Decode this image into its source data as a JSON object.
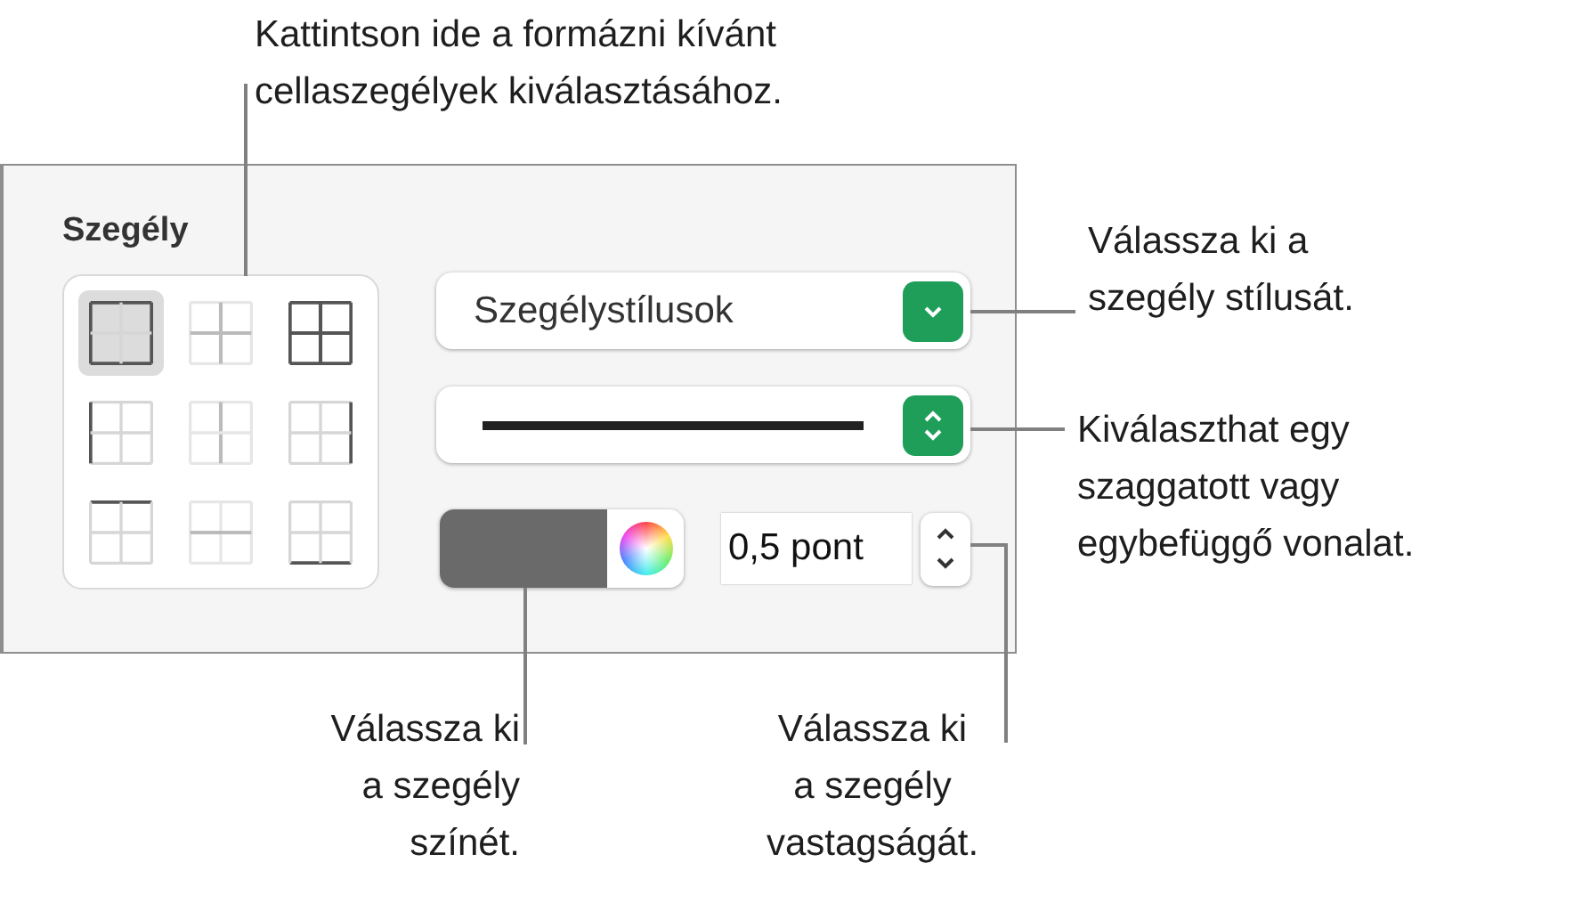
{
  "panel": {
    "title": "Szegély",
    "border_grid": [
      {
        "kind": "outer",
        "selected": true
      },
      {
        "kind": "inner",
        "selected": false
      },
      {
        "kind": "all",
        "selected": false
      },
      {
        "kind": "left",
        "selected": false
      },
      {
        "kind": "inner-vertical",
        "selected": false
      },
      {
        "kind": "right",
        "selected": false
      },
      {
        "kind": "top",
        "selected": false
      },
      {
        "kind": "inner-horizontal",
        "selected": false
      },
      {
        "kind": "bottom",
        "selected": false
      }
    ],
    "style_popup": {
      "value": "Szegélystílusok"
    },
    "line_popup": {
      "kind": "solid"
    },
    "color_well": {
      "color": "#6a6a6a"
    },
    "width_field": {
      "value": "0,5 pont"
    }
  },
  "callouts": [
    {
      "kind": "top",
      "text": "Kattintson ide a formázni kívánt\ncellaszegélyek kiválasztásához."
    },
    {
      "kind": "style",
      "text": "Válassza ki a\nszegély stílusát."
    },
    {
      "kind": "line",
      "text": "Kiválaszthat egy\nszaggatott vagy\negybefüggő vonalat."
    },
    {
      "kind": "color",
      "text": "Válassza ki\na szegély\nszínét."
    },
    {
      "kind": "width",
      "text": "Válassza ki\na szegély\nvastagságát."
    }
  ]
}
